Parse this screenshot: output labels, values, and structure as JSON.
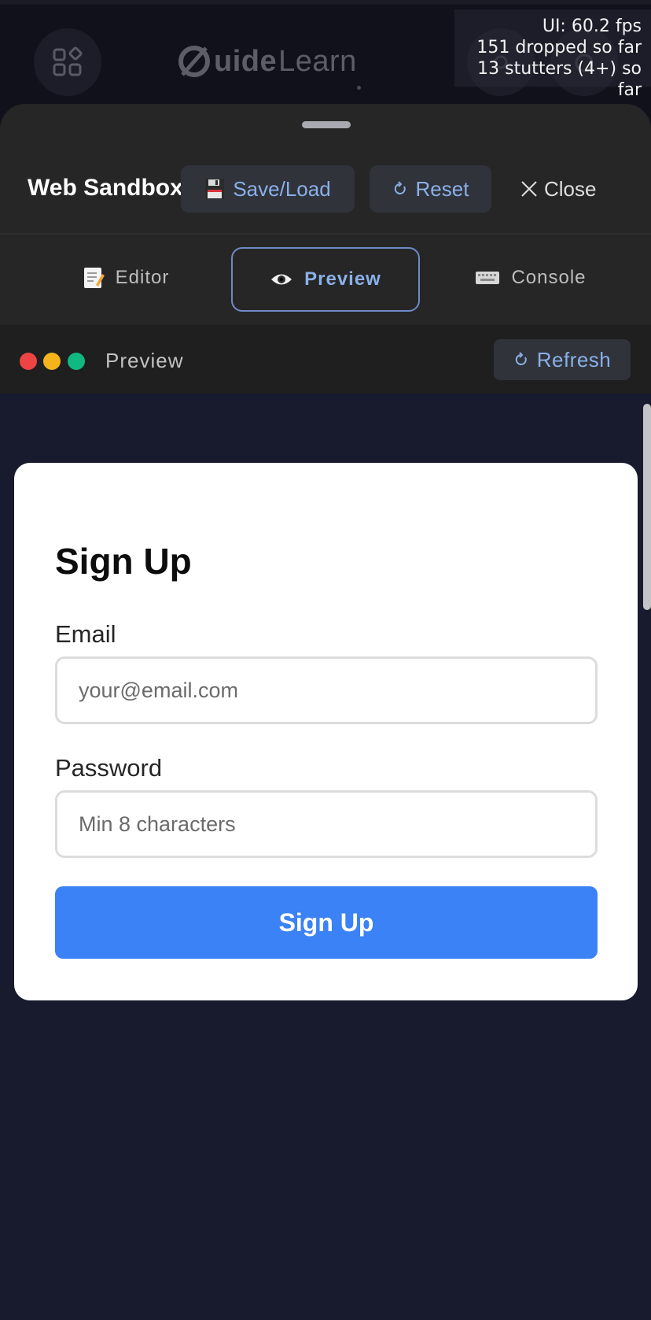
{
  "app_bar": {
    "logo_brand_first": "uide",
    "logo_brand_second": "Learn"
  },
  "fps_overlay": {
    "line1": "UI: 60.2 fps",
    "line2": "151 dropped so far",
    "line3": "13 stutters (4+) so far"
  },
  "sheet": {
    "title": "Web Sandbox",
    "save_label": "Save/Load",
    "reset_label": "Reset",
    "close_label": "Close"
  },
  "tabs": [
    {
      "label": "Editor",
      "icon": "memo-icon",
      "active": false
    },
    {
      "label": "Preview",
      "icon": "eye-icon",
      "active": true
    },
    {
      "label": "Console",
      "icon": "keyboard-icon",
      "active": false
    }
  ],
  "preview_bar": {
    "label": "Preview",
    "refresh_label": "Refresh"
  },
  "form": {
    "title": "Sign Up",
    "email_label": "Email",
    "email_placeholder": "your@email.com",
    "email_value": "",
    "password_label": "Password",
    "password_placeholder": "Min 8 characters",
    "password_value": "",
    "submit_label": "Sign Up"
  },
  "colors": {
    "accent": "#3b82f6",
    "tab_accent": "#8ab0e8",
    "sheet_bg": "#262626",
    "preview_bg": "#181a2e",
    "dot_red": "#ef4444",
    "dot_yellow": "#f5b41c",
    "dot_green": "#10b981"
  }
}
